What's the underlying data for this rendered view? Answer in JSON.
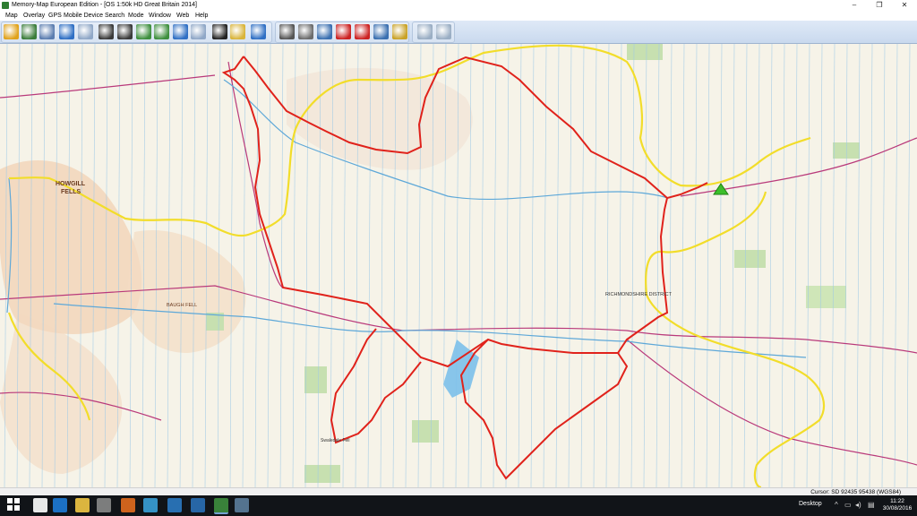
{
  "window": {
    "title": "Memory-Map European Edition - [OS 1:50k HD Great Britain 2014]",
    "controls": [
      "minimize",
      "restore",
      "close"
    ]
  },
  "menu": [
    "Map",
    "Overlay",
    "GPS",
    "Mobile Device",
    "Search",
    "Mode",
    "Window",
    "Web",
    "Help"
  ],
  "toolbar": {
    "buttons": [
      {
        "name": "open-icon",
        "color": "#e0a21b"
      },
      {
        "name": "overview-map-icon",
        "color": "#3b7d3b"
      },
      {
        "name": "properties-icon",
        "color": "#5b7db0"
      },
      {
        "name": "undo-icon",
        "color": "#2f6fc4"
      },
      {
        "name": "redo-icon",
        "color": "#8fa7c7"
      },
      {
        "name": "zoom-in-icon",
        "color": "#3a3a3a"
      },
      {
        "name": "zoom-out-icon",
        "color": "#3a3a3a"
      },
      {
        "name": "scale-up-icon",
        "color": "#3e8f3e"
      },
      {
        "name": "scale-down-icon",
        "color": "#3e8f3e"
      },
      {
        "name": "back-icon",
        "color": "#2f6fc4"
      },
      {
        "name": "forward-icon",
        "color": "#8fa7c7"
      },
      {
        "name": "binoculars-icon",
        "color": "#222"
      },
      {
        "name": "pointer-mode-icon",
        "color": "#d9b43a"
      },
      {
        "name": "help-icon",
        "color": "#2f6fc4"
      },
      {
        "name": "print-icon",
        "color": "#555"
      },
      {
        "name": "gps-tools-icon",
        "color": "#6c6c6c"
      },
      {
        "name": "route-icon",
        "color": "#3a6fb0"
      },
      {
        "name": "mark-icon",
        "color": "#cc2222"
      },
      {
        "name": "track-icon",
        "color": "#cc2222"
      },
      {
        "name": "text-icon",
        "color": "#3a6fb0"
      },
      {
        "name": "ruler-icon",
        "color": "#c9a227"
      },
      {
        "name": "device-upload-icon",
        "color": "#9aaec4"
      },
      {
        "name": "device-download-icon",
        "color": "#9aaec4"
      }
    ]
  },
  "map": {
    "labels": {
      "howgill_line1": "HOWGILL",
      "howgill_line2": "FELLS",
      "baugh_fell": "BAUGH FELL",
      "richmondshire_district": "RICHMONDSHIRE DISTRICT",
      "swaledale_fell": "Swaledale Fell"
    },
    "colors": {
      "route": "#e0221b",
      "boundary": "#f2dd2a",
      "land": "#f6f3e8",
      "grid": "#9ec9e6",
      "road": "#b9397a",
      "water": "#5ea8d8",
      "hill_shade": "#f2d3b6"
    },
    "marker_icon": "tent-icon"
  },
  "status": {
    "cursor": "Cursor: SD 92435 95438 (WGS84)"
  },
  "taskbar": {
    "items": [
      "windows-start-icon",
      "search-icon",
      "task-view-icon",
      "edge-icon",
      "file-explorer-icon",
      "calculator-icon",
      "firefox-icon",
      "paint-icon",
      "camera-icon",
      "photos-icon",
      "memory-map-icon",
      "window-switch-icon"
    ],
    "desktop_label": "Desktop",
    "time": "11:22",
    "date": "30/08/2016"
  }
}
